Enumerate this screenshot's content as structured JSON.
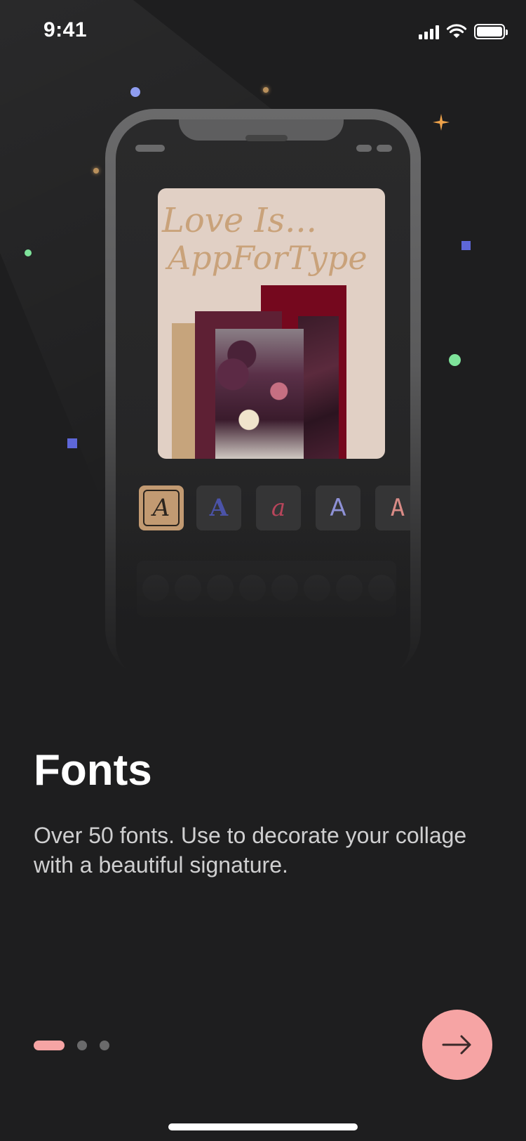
{
  "status_bar": {
    "time": "9:41",
    "icons": [
      "cellular-signal-icon",
      "wifi-icon",
      "battery-icon"
    ]
  },
  "mockup": {
    "collage_text_line1": "Love Is...",
    "collage_text_line2": "AppForType",
    "font_options": [
      {
        "glyph": "A",
        "selected": true,
        "color": "#2b241e"
      },
      {
        "glyph": "A",
        "selected": false,
        "color": "#4b53a8"
      },
      {
        "glyph": "a",
        "selected": false,
        "color": "#b8455b"
      },
      {
        "glyph": "A",
        "selected": false,
        "color": "#8e91d6"
      },
      {
        "glyph": "A",
        "selected": false,
        "color": "#d98b86"
      }
    ]
  },
  "onboarding": {
    "title": "Fonts",
    "description": "Over 50 fonts. Use to decorate your collage with a beautiful signature.",
    "page_count": 3,
    "current_page": 1
  },
  "colors": {
    "background": "#1e1e1f",
    "accent": "#f6a4a4",
    "inactive_dot": "#6a6a6b"
  },
  "next_button": {
    "icon": "arrow-right-icon"
  }
}
